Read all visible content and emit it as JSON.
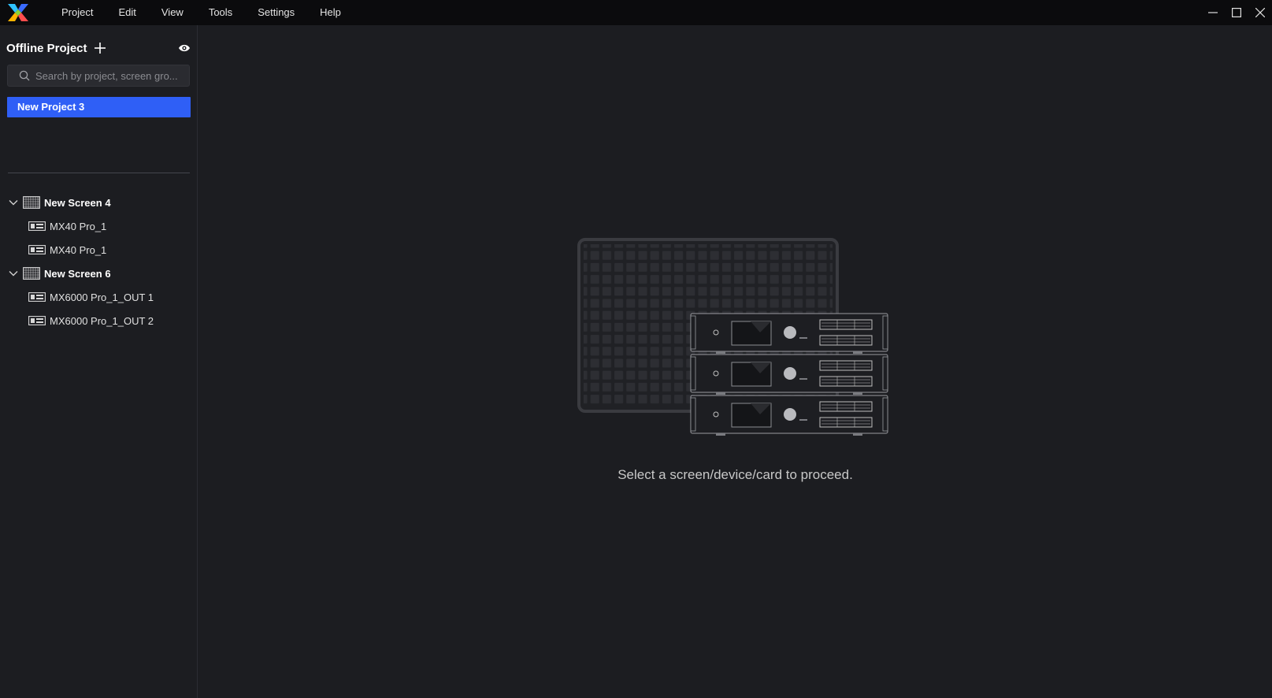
{
  "menu": {
    "items": [
      "Project",
      "Edit",
      "View",
      "Tools",
      "Settings",
      "Help"
    ]
  },
  "window_controls": {
    "icons": [
      "minimize-icon",
      "maximize-icon",
      "close-icon"
    ]
  },
  "sidebar": {
    "title": "Offline Project",
    "search": {
      "placeholder": "Search by project, screen gro...",
      "value": ""
    },
    "projects": [
      {
        "label": "New Project 3",
        "selected": true
      }
    ],
    "tree": [
      {
        "label": "New Screen 4",
        "expanded": true,
        "devices": [
          {
            "label": "MX40 Pro_1"
          },
          {
            "label": "MX40 Pro_1"
          }
        ]
      },
      {
        "label": "New Screen 6",
        "expanded": true,
        "devices": [
          {
            "label": "MX6000 Pro_1_OUT 1"
          },
          {
            "label": "MX6000 Pro_1_OUT 2"
          }
        ]
      }
    ]
  },
  "main": {
    "empty_message": "Select a screen/device/card to proceed."
  },
  "colors": {
    "accent": "#2f5ff6",
    "background": "#1c1d21",
    "titlebar": "#0b0b0d"
  }
}
